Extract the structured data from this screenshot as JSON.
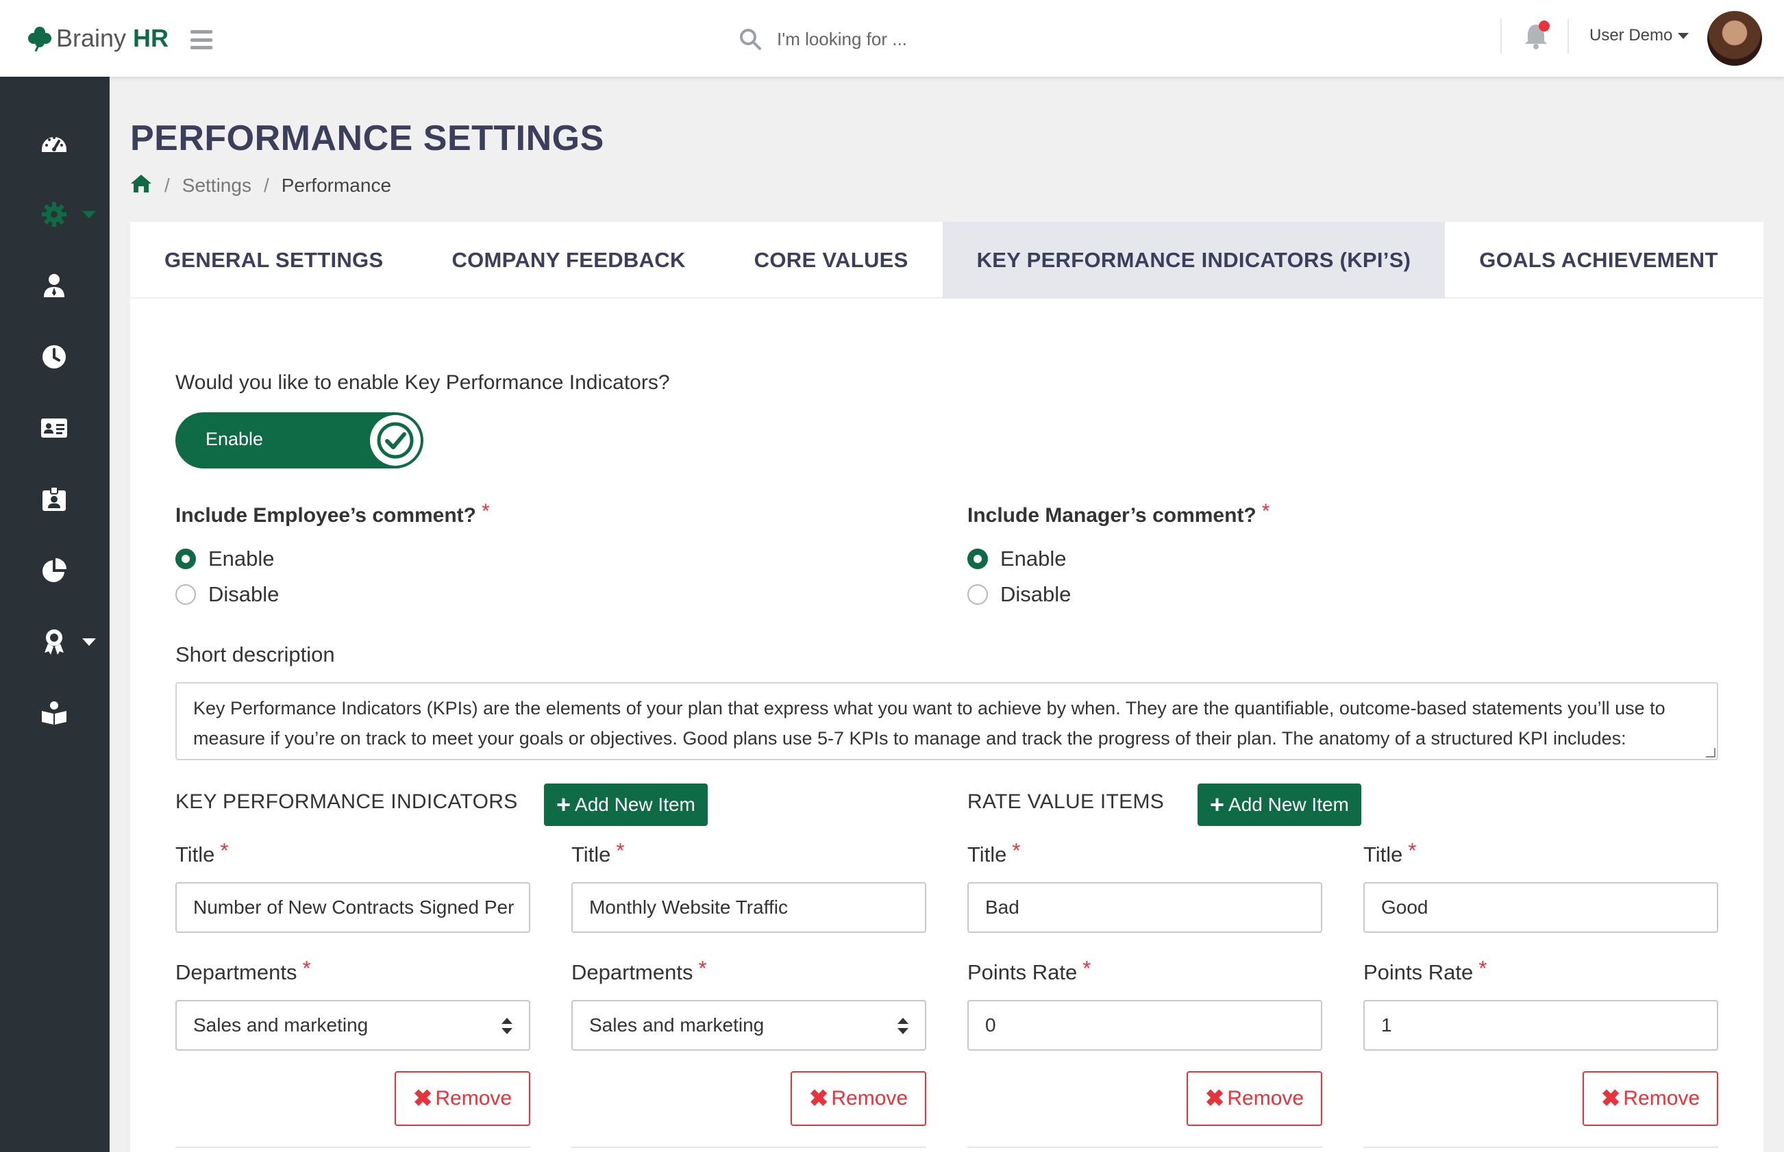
{
  "app": {
    "brand_name": "Brainy",
    "brand_suffix": "HR",
    "brand_color": "#0e6b45"
  },
  "header": {
    "search_placeholder": "I'm looking for ...",
    "user_name": "User Demo",
    "notification_badge": true
  },
  "sidebar": {
    "items": [
      {
        "icon": "dashboard-icon"
      },
      {
        "icon": "gear-icon",
        "active": true,
        "has_submenu": true
      },
      {
        "icon": "user-icon"
      },
      {
        "icon": "clock-icon"
      },
      {
        "icon": "id-card-icon"
      },
      {
        "icon": "badge-icon"
      },
      {
        "icon": "pie-chart-icon"
      },
      {
        "icon": "award-icon",
        "has_submenu": true
      },
      {
        "icon": "book-icon"
      }
    ]
  },
  "page": {
    "title": "PERFORMANCE SETTINGS",
    "breadcrumb": [
      "Settings",
      "Performance"
    ]
  },
  "tabs": [
    {
      "label": "GENERAL SETTINGS"
    },
    {
      "label": "COMPANY FEEDBACK"
    },
    {
      "label": "CORE VALUES"
    },
    {
      "label": "KEY PERFORMANCE INDICATORS (KPI’S)",
      "active": true
    },
    {
      "label": "GOALS ACHIEVEMENT"
    }
  ],
  "kpi": {
    "enable_question": "Would you like to enable Key Performance Indicators?",
    "enable_toggle_label": "Enable",
    "enabled": true,
    "employee_comment": {
      "label": "Include Employee’s comment?",
      "options": [
        "Enable",
        "Disable"
      ],
      "selected": "Enable"
    },
    "manager_comment": {
      "label": "Include Manager’s comment?",
      "options": [
        "Enable",
        "Disable"
      ],
      "selected": "Enable"
    },
    "short_description_label": "Short description",
    "short_description": "Key Performance Indicators (KPIs) are the elements of your plan that express what you want to achieve by when. They are the quantifiable, outcome-based statements you’ll use to measure if you’re on track to meet your goals or objectives. Good plans use 5-7 KPIs to manage and track the progress of their plan. The anatomy of a structured KPI includes:",
    "kpi_section_title": "KEY PERFORMANCE INDICATORS",
    "rate_section_title": "RATE VALUE ITEMS",
    "add_button_label": "Add New Item",
    "remove_button_label": "Remove",
    "title_label": "Title",
    "departments_label": "Departments",
    "points_rate_label": "Points Rate",
    "kpi_items": [
      {
        "title": "Number of New Contracts Signed Per",
        "department": "Sales and marketing"
      },
      {
        "title": "Monthly Website Traffic",
        "department": "Sales and marketing"
      }
    ],
    "rate_items": [
      {
        "title": "Bad",
        "points_rate": "0"
      },
      {
        "title": "Good",
        "points_rate": "1"
      }
    ]
  },
  "colors": {
    "primary": "#0e6b45",
    "danger": "#e8323c",
    "sidebar": "#2a3238",
    "heading": "#3b3f5c"
  }
}
